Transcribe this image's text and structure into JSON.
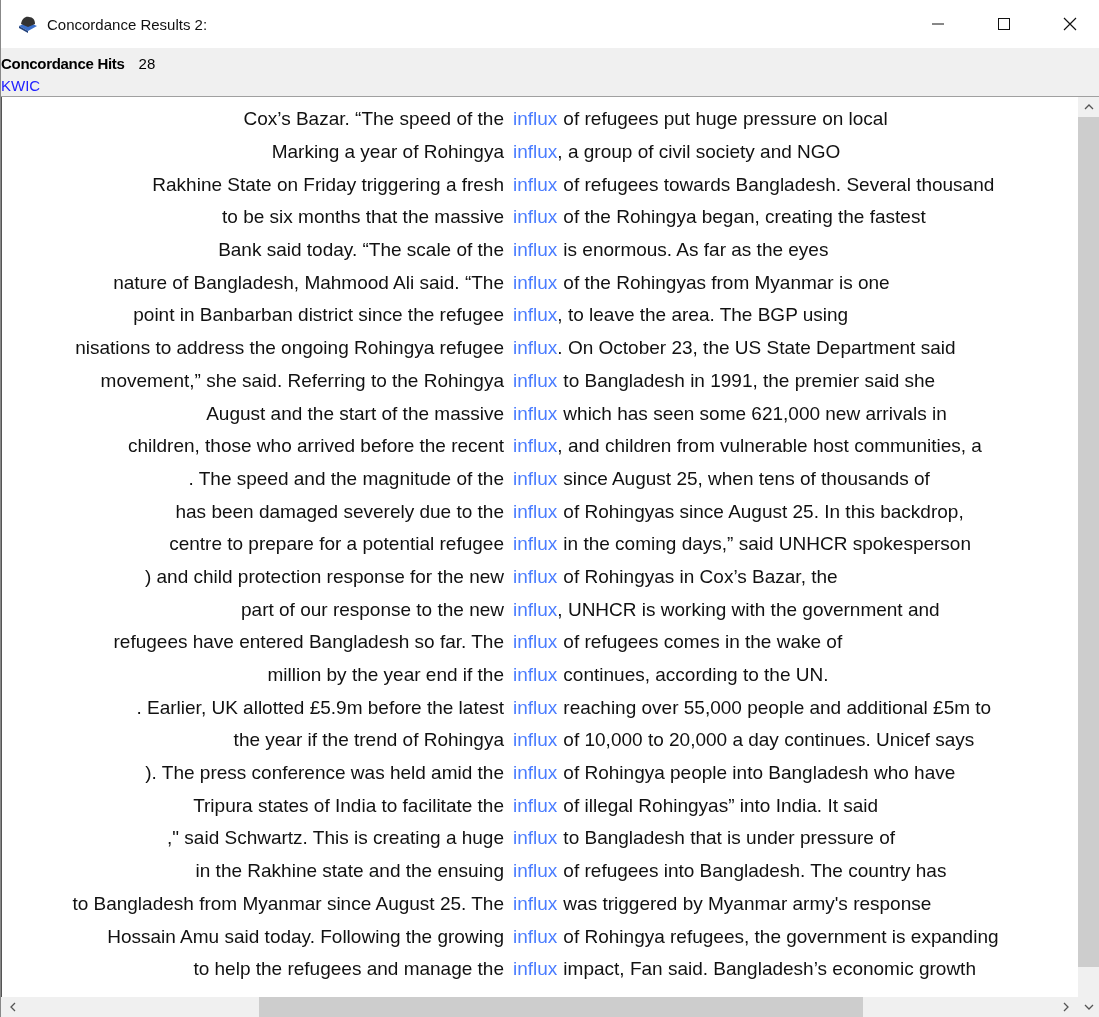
{
  "window": {
    "title": "Concordance Results 2:"
  },
  "hits": {
    "label": "Concordance Hits",
    "count": "28"
  },
  "view": {
    "label": "KWIC"
  },
  "rows": [
    {
      "left": "Cox’s Bazar. “The speed of the",
      "keyword": "influx",
      "right": "of refugees put huge pressure on local"
    },
    {
      "left": "Marking a year of Rohingya",
      "keyword": "influx",
      "right": ", a group of civil society and NGO"
    },
    {
      "left": "Rakhine State on Friday triggering a fresh",
      "keyword": "influx",
      "right": "of refugees towards Bangladesh. Several thousand"
    },
    {
      "left": "to be six months that the massive",
      "keyword": "influx",
      "right": "of the Rohingya began, creating the fastest"
    },
    {
      "left": "Bank said today.  “The scale of the",
      "keyword": "influx",
      "right": "is enormous. As far as the eyes"
    },
    {
      "left": "nature of Bangladesh, Mahmood Ali said. “The",
      "keyword": "influx",
      "right": "of the Rohingyas from Myanmar is one"
    },
    {
      "left": "point in Banbarban district since the refugee",
      "keyword": "influx",
      "right": ", to leave the area. The BGP using"
    },
    {
      "left": "nisations to address the ongoing Rohingya refugee",
      "keyword": "influx",
      "right": ". On October 23, the US State Department said"
    },
    {
      "left": "movement,” she said. Referring to the Rohingya",
      "keyword": "influx",
      "right": "to Bangladesh in 1991, the premier said she"
    },
    {
      "left": "August and the start of the massive",
      "keyword": "influx",
      "right": "which has seen some 621,000 new arrivals in"
    },
    {
      "left": "children, those who arrived before the recent",
      "keyword": "influx",
      "right": ", and children from vulnerable host communities, a"
    },
    {
      "left": ". The speed and the magnitude of the",
      "keyword": "influx",
      "right": "since August 25, when tens of thousands of"
    },
    {
      "left": "has been damaged severely due to the",
      "keyword": "influx",
      "right": "of Rohingyas since August 25. In this backdrop,"
    },
    {
      "left": "centre to prepare for a potential refugee",
      "keyword": "influx",
      "right": "in the coming days,” said UNHCR spokesperson"
    },
    {
      "left": ") and child protection response for the new",
      "keyword": "influx",
      "right": "of Rohingyas in Cox’s Bazar, the"
    },
    {
      "left": "part of our response to the new",
      "keyword": "influx",
      "right": ", UNHCR is working with the government and"
    },
    {
      "left": "refugees have entered Bangladesh so far. The",
      "keyword": "influx",
      "right": "of refugees comes in the wake of"
    },
    {
      "left": "million by the year end if the",
      "keyword": "influx",
      "right": "continues, according to the UN."
    },
    {
      "left": ". Earlier, UK allotted £5.9m before the latest",
      "keyword": "influx",
      "right": "reaching over 55,000 people and additional £5m to"
    },
    {
      "left": "the year if the trend of Rohingya",
      "keyword": "influx",
      "right": "of 10,000 to 20,000 a day continues. Unicef says"
    },
    {
      "left": "). The press conference was held amid the",
      "keyword": "influx",
      "right": "of Rohingya people into Bangladesh who have"
    },
    {
      "left": "Tripura states of India to facilitate the",
      "keyword": "influx",
      "right": "of illegal Rohingyas” into India. It said"
    },
    {
      "left": ",\" said Schwartz. This is creating a huge",
      "keyword": "influx",
      "right": "to Bangladesh that is under pressure of"
    },
    {
      "left": "in the Rakhine state and the ensuing",
      "keyword": "influx",
      "right": "of refugees into Bangladesh. The country has"
    },
    {
      "left": "to Bangladesh from Myanmar since August 25. The",
      "keyword": "influx",
      "right": "was triggered by Myanmar army's response"
    },
    {
      "left": "Hossain Amu said today. Following the growing",
      "keyword": "influx",
      "right": "of Rohingya refugees, the government is expanding"
    },
    {
      "left": "to help the refugees and manage the",
      "keyword": "influx",
      "right": "impact, Fan said. Bangladesh’s economic growth"
    }
  ]
}
